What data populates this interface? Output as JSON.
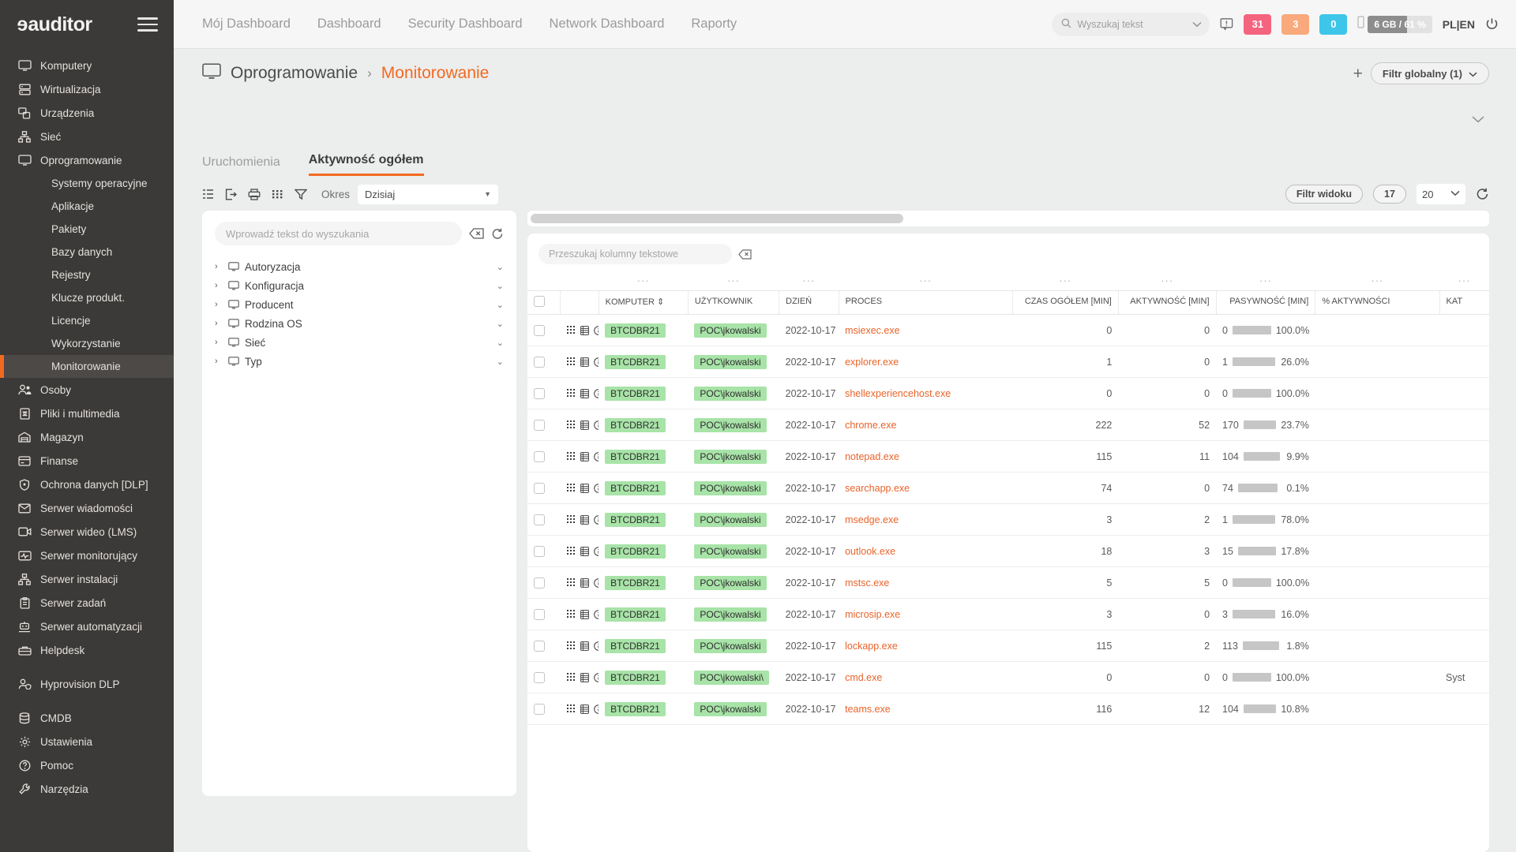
{
  "brand": {
    "logo": "eauditor",
    "accent": "#f26a21"
  },
  "sidebar": {
    "items": [
      {
        "label": "Komputery",
        "icon": "monitor-icon"
      },
      {
        "label": "Wirtualizacja",
        "icon": "server-icon"
      },
      {
        "label": "Urządzenia",
        "icon": "devices-icon"
      },
      {
        "label": "Sieć",
        "icon": "network-icon"
      },
      {
        "label": "Oprogramowanie",
        "icon": "monitor-icon"
      }
    ],
    "sub_items": [
      {
        "label": "Systemy operacyjne",
        "active": false
      },
      {
        "label": "Aplikacje",
        "active": false
      },
      {
        "label": "Pakiety",
        "active": false
      },
      {
        "label": "Bazy danych",
        "active": false
      },
      {
        "label": "Rejestry",
        "active": false
      },
      {
        "label": "Klucze produkt.",
        "active": false
      },
      {
        "label": "Licencje",
        "active": false
      },
      {
        "label": "Wykorzystanie",
        "active": false
      },
      {
        "label": "Monitorowanie",
        "active": true
      }
    ],
    "items2": [
      {
        "label": "Osoby",
        "icon": "people-icon"
      },
      {
        "label": "Pliki i multimedia",
        "icon": "file-icon"
      },
      {
        "label": "Magazyn",
        "icon": "warehouse-icon"
      },
      {
        "label": "Finanse",
        "icon": "card-icon"
      },
      {
        "label": "Ochrona danych [DLP]",
        "icon": "shield-icon"
      },
      {
        "label": "Serwer wiadomości",
        "icon": "mail-icon"
      },
      {
        "label": "Serwer wideo (LMS)",
        "icon": "video-icon"
      },
      {
        "label": "Serwer monitorujący",
        "icon": "pulse-icon"
      },
      {
        "label": "Serwer instalacji",
        "icon": "network-icon"
      },
      {
        "label": "Serwer zadań",
        "icon": "clipboard-icon"
      },
      {
        "label": "Serwer automatyzacji",
        "icon": "robot-icon"
      }
    ],
    "items3": [
      {
        "label": "Helpdesk",
        "icon": "toolbox-icon"
      }
    ],
    "items4": [
      {
        "label": "Hyprovision DLP",
        "icon": "user-shield-icon"
      }
    ],
    "items5": [
      {
        "label": "CMDB",
        "icon": "database-icon"
      },
      {
        "label": "Ustawienia",
        "icon": "gear-icon"
      },
      {
        "label": "Pomoc",
        "icon": "help-icon"
      },
      {
        "label": "Narzędzia",
        "icon": "wrench-icon"
      }
    ]
  },
  "topbar": {
    "nav": [
      "Mój Dashboard",
      "Dashboard",
      "Security Dashboard",
      "Network Dashboard",
      "Raporty"
    ],
    "search_placeholder": "Wyszukaj tekst",
    "badges": [
      {
        "value": "31",
        "color": "#f4647f"
      },
      {
        "value": "3",
        "color": "#f9a97b"
      },
      {
        "value": "0",
        "color": "#3ec6ea"
      }
    ],
    "memory": "6 GB / 61 %",
    "memory_percent": 61,
    "lang_pl": "PL",
    "lang_sep": "|",
    "lang_en": "EN"
  },
  "breadcrumb": {
    "parent": "Oprogramowanie",
    "separator": "›",
    "current": "Monitorowanie",
    "plus": "+",
    "global_filter": "Filtr globalny (1)"
  },
  "tabs": [
    {
      "label": "Uruchomienia",
      "active": false
    },
    {
      "label": "Aktywność ogółem",
      "active": true
    }
  ],
  "toolbar": {
    "okres_label": "Okres",
    "okres_value": "Dzisiaj",
    "view_filter": "Filtr widoku",
    "count": "17",
    "page_size": "20"
  },
  "filter_panel": {
    "search_placeholder": "Wprowadź tekst do wyszukania",
    "tree": [
      {
        "label": "Autoryzacja"
      },
      {
        "label": "Konfiguracja"
      },
      {
        "label": "Producent"
      },
      {
        "label": "Rodzina OS"
      },
      {
        "label": "Sieć"
      },
      {
        "label": "Typ"
      }
    ]
  },
  "table": {
    "search_placeholder": "Przeszukaj kolumny tekstowe",
    "columns": [
      "KOMPUTER",
      "UŻYTKOWNIK",
      "DZIEŃ",
      "PROCES",
      "CZAS OGÓŁEM [min]",
      "AKTYWNOŚĆ [min]",
      "PASYWNOŚĆ [min]",
      "% AKTYWNOŚCI",
      "KAT"
    ],
    "sort_column": "KOMPUTER",
    "rows": [
      {
        "computer": "BTCDBR21",
        "user": "POC\\jkowalski",
        "day": "2022-10-17",
        "process": "msiexec.exe",
        "total": "0",
        "active": "0",
        "passive": "0",
        "pct": "100.0%",
        "pct_value": 100,
        "kat": ""
      },
      {
        "computer": "BTCDBR21",
        "user": "POC\\jkowalski",
        "day": "2022-10-17",
        "process": "explorer.exe",
        "total": "1",
        "active": "0",
        "passive": "1",
        "pct": "26.0%",
        "pct_value": 26,
        "kat": ""
      },
      {
        "computer": "BTCDBR21",
        "user": "POC\\jkowalski",
        "day": "2022-10-17",
        "process": "shellexperiencehost.exe",
        "total": "0",
        "active": "0",
        "passive": "0",
        "pct": "100.0%",
        "pct_value": 100,
        "kat": ""
      },
      {
        "computer": "BTCDBR21",
        "user": "POC\\jkowalski",
        "day": "2022-10-17",
        "process": "chrome.exe",
        "total": "222",
        "active": "52",
        "passive": "170",
        "pct": "23.7%",
        "pct_value": 23.7,
        "kat": ""
      },
      {
        "computer": "BTCDBR21",
        "user": "POC\\jkowalski",
        "day": "2022-10-17",
        "process": "notepad.exe",
        "total": "115",
        "active": "11",
        "passive": "104",
        "pct": "9.9%",
        "pct_value": 9.9,
        "kat": ""
      },
      {
        "computer": "BTCDBR21",
        "user": "POC\\jkowalski",
        "day": "2022-10-17",
        "process": "searchapp.exe",
        "total": "74",
        "active": "0",
        "passive": "74",
        "pct": "0.1%",
        "pct_value": 0.1,
        "kat": ""
      },
      {
        "computer": "BTCDBR21",
        "user": "POC\\jkowalski",
        "day": "2022-10-17",
        "process": "msedge.exe",
        "total": "3",
        "active": "2",
        "passive": "1",
        "pct": "78.0%",
        "pct_value": 78,
        "kat": ""
      },
      {
        "computer": "BTCDBR21",
        "user": "POC\\jkowalski",
        "day": "2022-10-17",
        "process": "outlook.exe",
        "total": "18",
        "active": "3",
        "passive": "15",
        "pct": "17.8%",
        "pct_value": 17.8,
        "kat": ""
      },
      {
        "computer": "BTCDBR21",
        "user": "POC\\jkowalski",
        "day": "2022-10-17",
        "process": "mstsc.exe",
        "total": "5",
        "active": "5",
        "passive": "0",
        "pct": "100.0%",
        "pct_value": 100,
        "kat": ""
      },
      {
        "computer": "BTCDBR21",
        "user": "POC\\jkowalski",
        "day": "2022-10-17",
        "process": "microsip.exe",
        "total": "3",
        "active": "0",
        "passive": "3",
        "pct": "16.0%",
        "pct_value": 16,
        "kat": ""
      },
      {
        "computer": "BTCDBR21",
        "user": "POC\\jkowalski",
        "day": "2022-10-17",
        "process": "lockapp.exe",
        "total": "115",
        "active": "2",
        "passive": "113",
        "pct": "1.8%",
        "pct_value": 1.8,
        "kat": ""
      },
      {
        "computer": "BTCDBR21",
        "user": "POC\\jkowalski\\",
        "day": "2022-10-17",
        "process": "cmd.exe",
        "total": "0",
        "active": "0",
        "passive": "0",
        "pct": "100.0%",
        "pct_value": 100,
        "kat": "Syst"
      },
      {
        "computer": "BTCDBR21",
        "user": "POC\\jkowalski",
        "day": "2022-10-17",
        "process": "teams.exe",
        "total": "116",
        "active": "12",
        "passive": "104",
        "pct": "10.8%",
        "pct_value": 10.8,
        "kat": ""
      }
    ]
  }
}
